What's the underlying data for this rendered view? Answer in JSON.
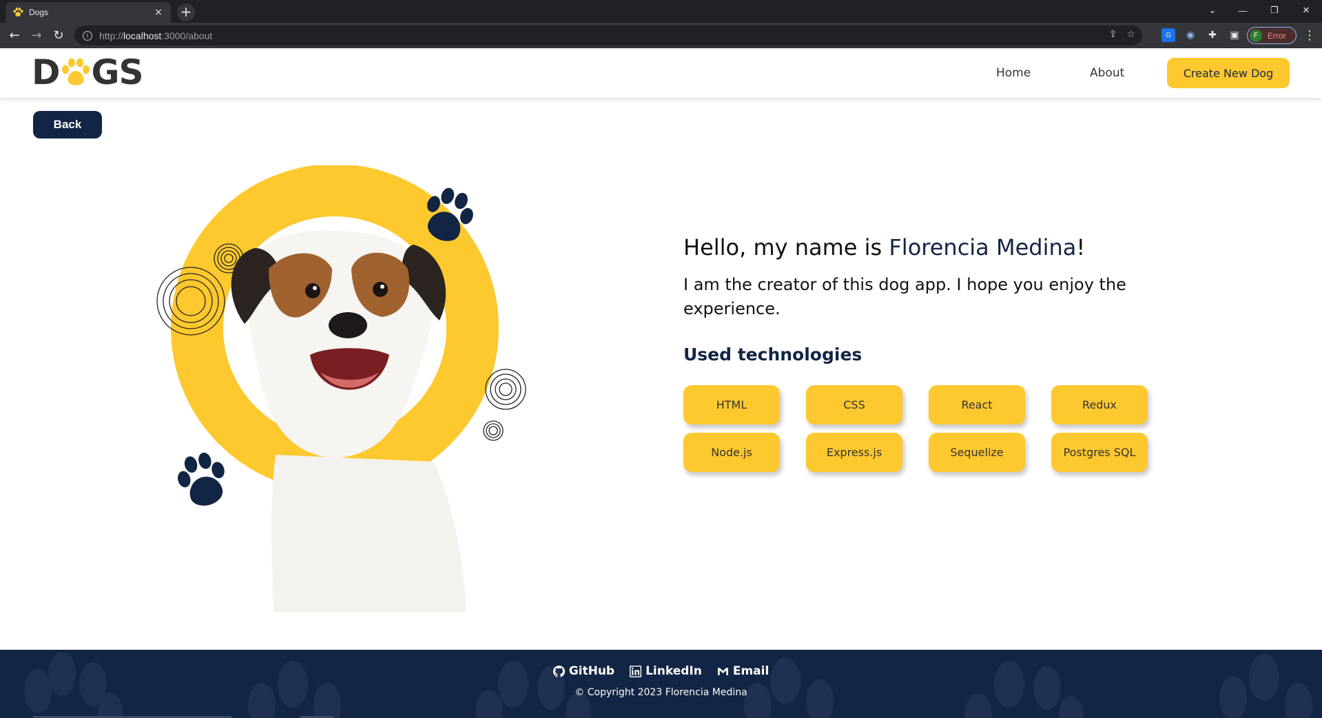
{
  "browser": {
    "tab_title": "Dogs",
    "tab_close": "×",
    "new_tab": "+",
    "url_scheme": "http://",
    "url_host": "localhost",
    "url_path": ":3000/about",
    "profile_initial": "F",
    "profile_status": "Error"
  },
  "header": {
    "logo_left": "D",
    "logo_right": "GS",
    "nav": {
      "home": "Home",
      "about": "About"
    },
    "create_button": "Create New Dog"
  },
  "back_button": "Back",
  "about": {
    "greeting_prefix": "Hello, my name is ",
    "name": "Florencia Medina",
    "greeting_suffix": "!",
    "intro": "I am the creator of this dog app. I hope you enjoy the experience.",
    "tech_title": "Used technologies",
    "technologies": [
      "HTML",
      "CSS",
      "React",
      "Redux",
      "Node.js",
      "Express.js",
      "Sequelize",
      "Postgres SQL"
    ]
  },
  "footer": {
    "github": "GitHub",
    "linkedin": "LinkedIn",
    "email": "Email",
    "copyright": "© Copyright 2023 Florencia Medina"
  },
  "colors": {
    "brand_yellow": "#fec82f",
    "brand_navy": "#132544"
  }
}
